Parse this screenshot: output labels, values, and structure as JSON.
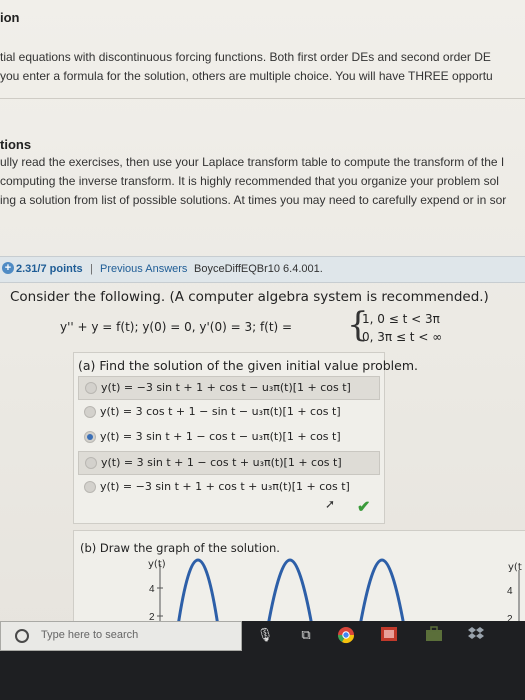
{
  "top": {
    "heading_partial": "ion",
    "intro_line1": "tial equations with discontinuous forcing functions. Both first order DEs and second order DE",
    "intro_line2": "you enter a formula for the solution, others are multiple choice. You will have THREE opportu",
    "section2_heading": "tions",
    "inst_line1": "ully read the exercises, then use your Laplace transform table to compute the transform of the I",
    "inst_line2": "computing the inverse transform. It is highly recommended that you organize your problem sol",
    "inst_line3": "ing a solution from list of possible solutions. At times you may need to carefully expend or in sor"
  },
  "question_bar": {
    "points": "2.31/7 points",
    "separator": "|",
    "previous_answers": "Previous Answers",
    "code": "BoyceDiffEQBr10 6.4.001."
  },
  "question": {
    "prompt": "Consider the following. (A computer algebra system is recommended.)",
    "equation": "y'' + y = f(t);   y(0) = 0,   y'(0) = 3;   f(t) =",
    "piece1": "1,   0 ≤ t < 3π",
    "piece2": "0,   3π ≤ t < ∞"
  },
  "part_a": {
    "title": "(a) Find the solution of the given initial value problem.",
    "options": [
      {
        "text": "y(t) = −3 sin t + 1 + cos t − u₃π(t)[1 + cos t]",
        "selected": false
      },
      {
        "text": "y(t) = 3 cos t + 1 − sin t − u₃π(t)[1 + cos t]",
        "selected": false
      },
      {
        "text": "y(t) = 3 sin t + 1 − cos t − u₃π(t)[1 + cos t]",
        "selected": true
      },
      {
        "text": "y(t) = 3 sin t + 1 − cos t + u₃π(t)[1 + cos t]",
        "selected": false
      },
      {
        "text": "y(t) = −3 sin t + 1 + cos t + u₃π(t)[1 + cos t]",
        "selected": false
      }
    ],
    "check_icon": "checkmark-icon"
  },
  "part_b": {
    "title": "(b) Draw the graph of the solution.",
    "left_ylabel": "y(t)",
    "right_ylabel": "y(t",
    "tick_4": "4",
    "tick_2": "2"
  },
  "taskbar": {
    "search_placeholder": "Type here to search",
    "icons": [
      "microphone-icon",
      "task-view-icon",
      "chrome-icon",
      "app-icon",
      "store-icon",
      "dropbox-icon"
    ]
  }
}
